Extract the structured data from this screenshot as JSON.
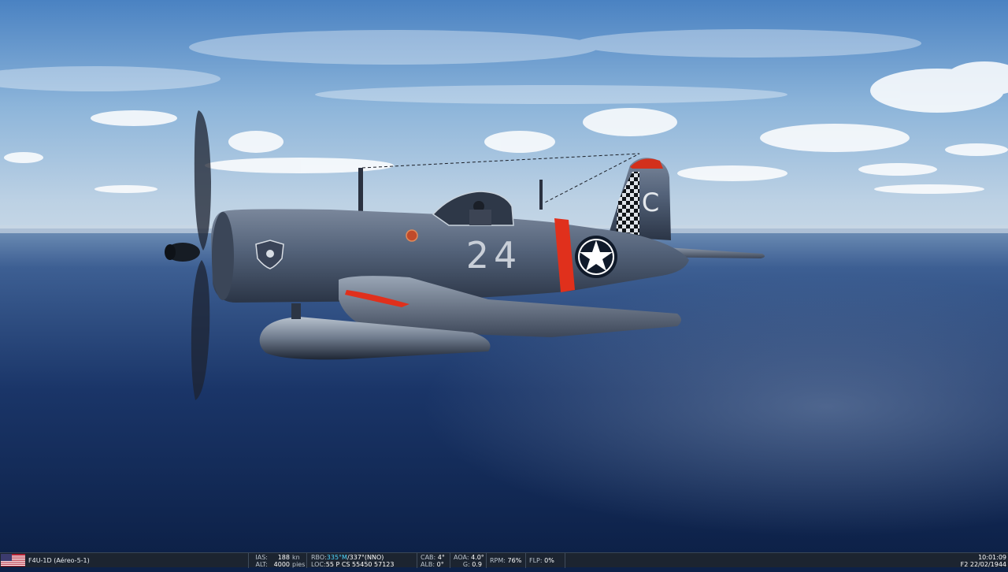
{
  "aircraft": {
    "tail_letter": "C",
    "side_number": "24"
  },
  "hud": {
    "flag_icon": "usa-flag-icon",
    "unit_name": "F4U-1D (Aéreo-5-1)",
    "ias_label": "IAS:",
    "ias_value": "188",
    "ias_unit": "kn",
    "alt_label": "ALT:",
    "alt_value": "4000",
    "alt_unit": "pies",
    "rbo_label": "RBO:",
    "rbo_mag": "335°M",
    "rbo_rest": "/337°(NNO)",
    "loc_label": "LOC:",
    "loc_value": "55 P CS 55450 57123",
    "cab_label": "CAB:",
    "cab_value": "4°",
    "alb_label": "ALB:",
    "alb_value": "0°",
    "aoa_label": "AOA:",
    "aoa_value": "4.0°",
    "g_label": "G:",
    "g_value": "0.9",
    "rpm_label": "RPM:",
    "rpm_value": "76%",
    "flp_label": "FLP:",
    "flp_value": "0%",
    "time": "10:01:09",
    "date": "F2 22/02/1944"
  },
  "colors": {
    "sky_top": "#4a82c2",
    "horizon": "#c6d7e6",
    "sea_deep": "#0d2148",
    "plane_body": "#4d5c74",
    "red_stripe": "#e0301c",
    "hud_bg": "#1c2430",
    "hud_highlight": "#4fd6ff"
  }
}
